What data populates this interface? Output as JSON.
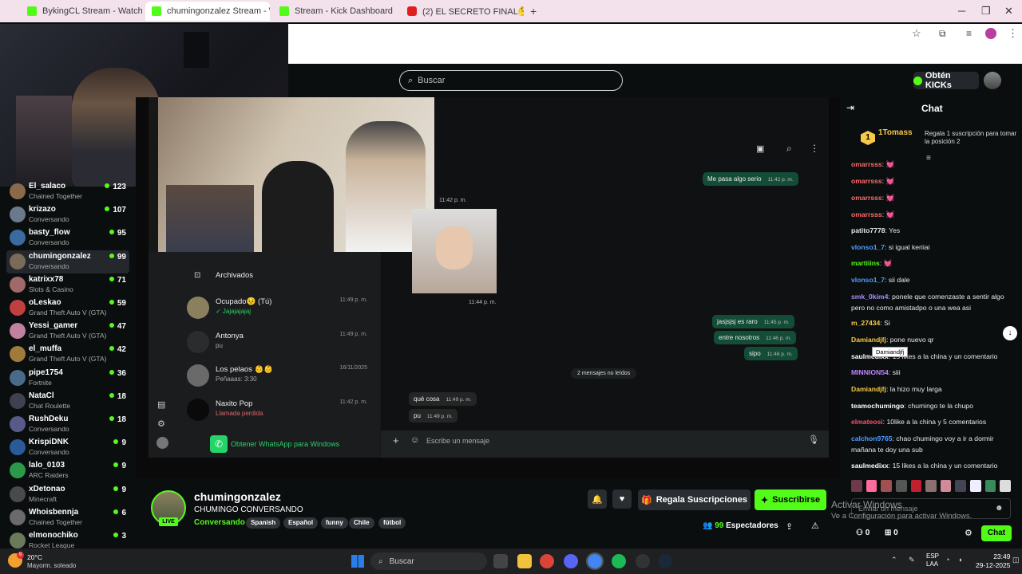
{
  "browser": {
    "tabs": [
      {
        "title": "BykingCL Stream - Watch Live o",
        "favicon": "kick"
      },
      {
        "title": "chumingonzalez Stream - W",
        "favicon": "kick",
        "active": true
      },
      {
        "title": "Stream - Kick Dashboard",
        "favicon": "kick"
      },
      {
        "title": "(2) EL SECRETO FINAL🤔 Capít",
        "favicon": "youtube"
      }
    ]
  },
  "header": {
    "search_placeholder": "Buscar",
    "get_kicks": "Obtén KICKs"
  },
  "sidebar": {
    "items": [
      {
        "name": "El_salaco",
        "category": "Chained Together",
        "viewers": "123"
      },
      {
        "name": "krizazo",
        "category": "Conversando",
        "viewers": "107"
      },
      {
        "name": "basty_flow",
        "category": "Conversando",
        "viewers": "95"
      },
      {
        "name": "chumingonzalez",
        "category": "Conversando",
        "viewers": "99",
        "active": true
      },
      {
        "name": "katrixx78",
        "category": "Slots & Casino",
        "viewers": "71"
      },
      {
        "name": "oLeskao",
        "category": "Grand Theft Auto V (GTA)",
        "viewers": "59"
      },
      {
        "name": "Yessi_gamer",
        "category": "Grand Theft Auto V (GTA)",
        "viewers": "47"
      },
      {
        "name": "el_muffa",
        "category": "Grand Theft Auto V (GTA)",
        "viewers": "42"
      },
      {
        "name": "pipe1754",
        "category": "Fortnite",
        "viewers": "36"
      },
      {
        "name": "NataCl",
        "category": "Chat Roulette",
        "viewers": "18"
      },
      {
        "name": "RushDeku",
        "category": "Conversando",
        "viewers": "18"
      },
      {
        "name": "KrispiDNK",
        "category": "Conversando",
        "viewers": "9"
      },
      {
        "name": "lalo_0103",
        "category": "ARC Raiders",
        "viewers": "9"
      },
      {
        "name": "xDetonao",
        "category": "Minecraft",
        "viewers": "9"
      },
      {
        "name": "Whoisbennja",
        "category": "Chained Together",
        "viewers": "6"
      },
      {
        "name": "elmonochiko",
        "category": "Rocket League",
        "viewers": "3"
      }
    ]
  },
  "whatsapp": {
    "archived": "Archivados",
    "chats": [
      {
        "name": "Ocupado😣 (Tú)",
        "preview": "✓ Jajajajajaj",
        "time": "11:49 p. m."
      },
      {
        "name": "Antonya",
        "preview": "pu",
        "time": "11:49 p. m."
      },
      {
        "name": "Los pelaos 👶👶",
        "preview": "Peñaaas: 3:30",
        "time": "16/11/2025"
      },
      {
        "name": "Naxito Pop",
        "preview": "Llamada perdida",
        "time": "11:42 p. m."
      }
    ],
    "get_app": "Obtener WhatsApp para Windows",
    "messages_out": [
      {
        "text": "Me pasa algo serio",
        "time": "11:42 p. m."
      },
      {
        "text": "jasjsjsj es raro",
        "time": "11:45 p. m."
      },
      {
        "text": "entre nosotros",
        "time": "11:46 p. m."
      },
      {
        "text": "sipo",
        "time": "11:46 p. m."
      }
    ],
    "time_a": "11:42 p. m.",
    "time_b": "11:44 p. m.",
    "unread": "2 mensajes no leídos",
    "messages_in": [
      {
        "text": "qué cosa",
        "time": "11:49 p. m."
      },
      {
        "text": "pu",
        "time": "11:49 p. m."
      }
    ],
    "input_placeholder": "Escribe un mensaje"
  },
  "stream": {
    "channel": "chumingonzalez",
    "title": "CHUMINGO CONVERSANDO",
    "category": "Conversando",
    "live": "LIVE",
    "tags": [
      "Spanish",
      "Español",
      "funny",
      "Chile",
      "fútbol"
    ],
    "gift_label": "Regala Suscripciones",
    "subscribe_label": "Suscribirse",
    "viewers": "99",
    "viewers_label": "Espectadores"
  },
  "chat": {
    "title": "Chat",
    "pinned_user": "1Tomass",
    "pinned_rank": "1",
    "pinned_text": "Regala 1 suscripción para tomar la posición 2",
    "messages": [
      {
        "user": "omarrsss",
        "text": "💓",
        "color": "#ff6b6b"
      },
      {
        "user": "omarrsss",
        "text": "💓",
        "color": "#ff6b6b"
      },
      {
        "user": "omarrsss",
        "text": "💓",
        "color": "#ff6b6b"
      },
      {
        "user": "omarrsss",
        "text": "💓",
        "color": "#ff6b6b"
      },
      {
        "user": "patito7778",
        "text": "Yes",
        "color": "#e8e8e8"
      },
      {
        "user": "vlonso1_7",
        "text": "si igual keriiai",
        "color": "#4f9dff"
      },
      {
        "user": "martiiins",
        "text": "💓",
        "color": "#53fc18"
      },
      {
        "user": "vlonso1_7",
        "text": "sii dale",
        "color": "#4f9dff"
      },
      {
        "user": "smk_0kim4",
        "text": "ponele que comenzaste a sentir algo pero no como amistadpo o una wea asi",
        "color": "#a78bfa"
      },
      {
        "user": "m_27434",
        "text": "Si",
        "color": "#f7c948"
      },
      {
        "user": "Damiandjfj",
        "text": "pone nuevo qr",
        "color": "#f7c948"
      },
      {
        "user": "saulmedixx",
        "text": "15 likes a la china y un comentario",
        "color": "#ffffff"
      },
      {
        "user": "MINNION54",
        "text": "siii",
        "color": "#c084fc"
      },
      {
        "user": "Damiandjfj",
        "text": "la hizo muy larga",
        "color": "#f7c948"
      },
      {
        "user": "teamochumingo",
        "text": "chumingo te la chupo",
        "color": "#ffffff"
      },
      {
        "user": "elmateosi",
        "text": "10like a la china y 5 comentarios",
        "color": "#ff4d6d"
      },
      {
        "user": "calchon9765",
        "text": "chao chumingo voy a ir a dormir mañana te doy una sub",
        "color": "#4f9dff"
      },
      {
        "user": "saulmedixx",
        "text": "15 likes a la china y un comentario",
        "color": "#ffffff"
      }
    ],
    "tooltip": "Damiandjfj",
    "input_placeholder": "Enviar un mensaje",
    "send_label": "Chat",
    "kicks": "0",
    "gifts": "0"
  },
  "windows_activation": {
    "line1": "Activar Windows",
    "line2": "Ve a Configuración para activar Windows."
  },
  "taskbar": {
    "weather_temp": "20°C",
    "weather_desc": "Mayorm. soleado",
    "search": "Buscar",
    "lang1": "ESP",
    "lang2": "LAA",
    "time": "23:49",
    "date": "29-12-2025",
    "badge": "9"
  },
  "colors": {
    "accent": "#53fc18",
    "background": "#0b0e0f"
  }
}
